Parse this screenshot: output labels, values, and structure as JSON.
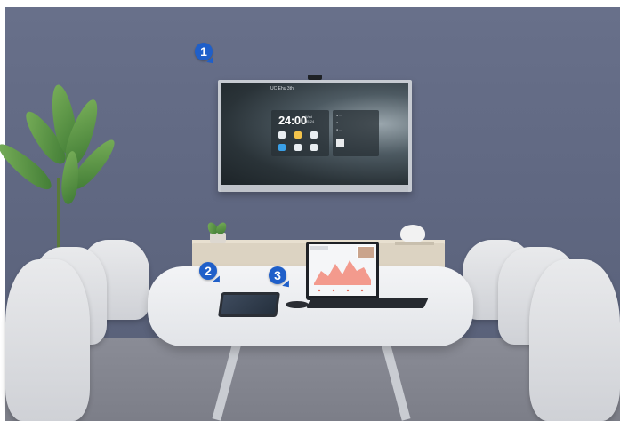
{
  "scene": {
    "description_badges": [
      {
        "number": "1",
        "target": "display"
      },
      {
        "number": "2",
        "target": "touch-panel"
      },
      {
        "number": "3",
        "target": "wireless-presentation-pod"
      }
    ]
  },
  "display": {
    "topbar_text": "UC Ehu 3th",
    "time": "24:00",
    "date_line1": "Wed",
    "date_line2": "05-24",
    "info_rows": [
      "● ...",
      "● ...",
      "● ..."
    ],
    "apps": [
      {
        "color": "#e9eef2"
      },
      {
        "color": "#f3c34b"
      },
      {
        "color": "#e9eef2"
      },
      {
        "color": "#3aa0e8"
      },
      {
        "color": "#e9eef2"
      },
      {
        "color": "#e9eef2"
      }
    ]
  },
  "colors": {
    "badge": "#1f5fc9",
    "wall": "#636b85",
    "chart_fill": "#f28a7a"
  }
}
